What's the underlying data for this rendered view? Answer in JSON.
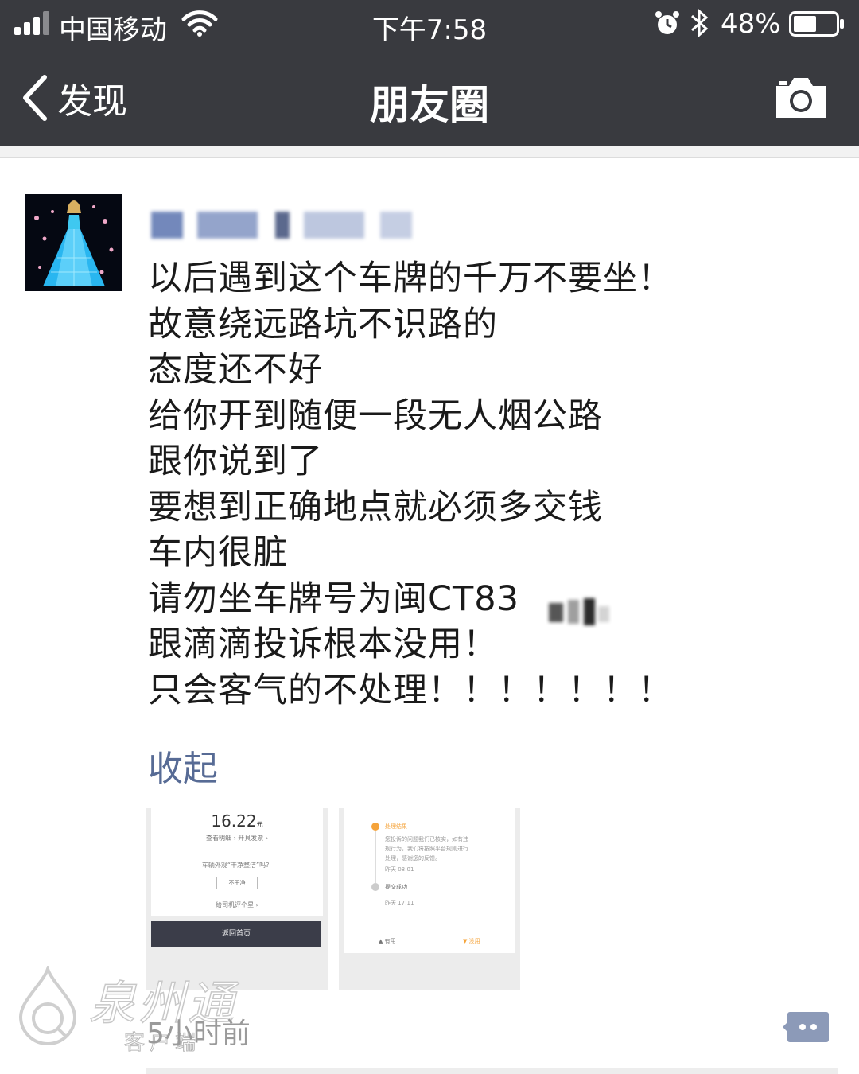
{
  "status_bar": {
    "carrier": "中国移动",
    "time": "下午7:58",
    "battery": "48%",
    "icons": [
      "signal-icon",
      "wifi-icon",
      "alarm-icon",
      "bluetooth-icon",
      "battery-icon"
    ]
  },
  "nav": {
    "back_label": "发现",
    "title": "朋友圈",
    "right_icon": "camera-icon",
    "background": "#393a3f"
  },
  "post": {
    "username": "",
    "lines": [
      "以后遇到这个车牌的千万不要坐！",
      "故意绕远路坑不识路的",
      "态度还不好",
      "给你开到随便一段无人烟公路",
      "跟你说到了",
      "要想到正确地点就必须多交钱",
      "车内很脏",
      "请勿坐车牌号为闽CT83",
      "跟滴滴投诉根本没用！",
      "只会客气的不处理！！！！！！！"
    ],
    "collapse_label": "收起",
    "link_color": "#576b95",
    "images": [
      {
        "amount": "16.22",
        "amount_unit": "元",
        "links": "查看明细 ›      开具发票 ›",
        "question": "车辆外观“干净整洁”吗？",
        "choice": "不干净",
        "more": "给司机评个星 ›",
        "home_button": "返回首页"
      },
      {
        "step1_title": "处理结果",
        "step1_body_1": "您投诉的问题我们已核实，如有违",
        "step1_body_2": "规行为，我们将按照平台规则进行",
        "step1_body_3": "处理，感谢您的反馈。",
        "step1_time": "昨天 08:01",
        "step2_title": "提交成功",
        "step2_time": "昨天 17:11",
        "useful": "有用",
        "useless": "没用"
      }
    ],
    "timestamp": "5小时前"
  },
  "watermark": {
    "title": "泉州通",
    "subtitle": "客户端"
  }
}
